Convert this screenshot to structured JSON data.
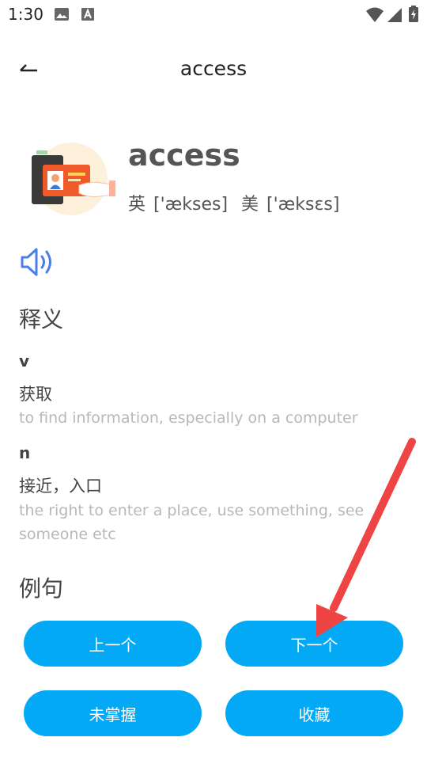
{
  "status_bar": {
    "time": "1:30",
    "icons": [
      "image-icon",
      "text-a-icon",
      "wifi-icon",
      "signal-icon",
      "battery-charging-icon"
    ]
  },
  "header": {
    "back_icon": "back-arrow-icon",
    "title": "access"
  },
  "word": {
    "text": "access",
    "uk_label": "英",
    "uk_phonetic": "['ækses]",
    "us_label": "美",
    "us_phonetic": "['æksɛs]",
    "illustration_icon": "id-card-in-hand-illustration"
  },
  "pronounce_icon": "speaker-icon",
  "definition_section": {
    "title": "释义",
    "entries": [
      {
        "pos": "v",
        "zh": "获取",
        "en": "to find information, especially on a computer"
      },
      {
        "pos": "n",
        "zh": "接近，入口",
        "en": "the right to enter a place, use something, see someone etc"
      }
    ]
  },
  "examples_section": {
    "title": "例句"
  },
  "buttons": {
    "prev": "上一个",
    "next": "下一个",
    "not_mastered": "未掌握",
    "favorite": "收藏"
  },
  "colors": {
    "accent": "#03a9f4",
    "annotation_arrow": "#ef4444",
    "speaker": "#4a7fe6"
  }
}
